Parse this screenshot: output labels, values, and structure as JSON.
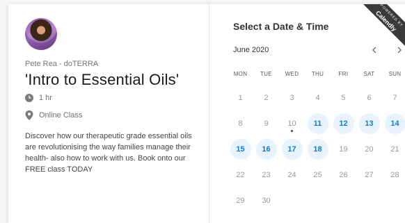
{
  "host": "Pete Rea - doTERRA",
  "event_title": "'Intro to Essential Oils'",
  "duration": "1 hr",
  "location": "Online Class",
  "description": "Discover how our therapeutic grade essential oils are revolutionising the way families manage their health- also how to work with us. Book onto our FREE class TODAY",
  "calendar": {
    "heading": "Select a Date & Time",
    "month_label": "June 2020",
    "weekdays": [
      "MON",
      "TUE",
      "WED",
      "THU",
      "FRI",
      "SAT",
      "SUN"
    ],
    "days": [
      {
        "n": "1",
        "available": false
      },
      {
        "n": "2",
        "available": false
      },
      {
        "n": "3",
        "available": false
      },
      {
        "n": "4",
        "available": false
      },
      {
        "n": "5",
        "available": false
      },
      {
        "n": "6",
        "available": false
      },
      {
        "n": "7",
        "available": false
      },
      {
        "n": "8",
        "available": false
      },
      {
        "n": "9",
        "available": false
      },
      {
        "n": "10",
        "available": false,
        "today": true
      },
      {
        "n": "11",
        "available": true
      },
      {
        "n": "12",
        "available": true
      },
      {
        "n": "13",
        "available": true
      },
      {
        "n": "14",
        "available": true
      },
      {
        "n": "15",
        "available": true
      },
      {
        "n": "16",
        "available": true
      },
      {
        "n": "17",
        "available": true
      },
      {
        "n": "18",
        "available": true
      },
      {
        "n": "19",
        "available": false
      },
      {
        "n": "20",
        "available": false
      },
      {
        "n": "21",
        "available": false
      },
      {
        "n": "22",
        "available": false
      },
      {
        "n": "23",
        "available": false
      },
      {
        "n": "24",
        "available": false
      },
      {
        "n": "25",
        "available": false
      },
      {
        "n": "26",
        "available": false
      },
      {
        "n": "27",
        "available": false
      },
      {
        "n": "28",
        "available": false
      },
      {
        "n": "29",
        "available": false
      },
      {
        "n": "30",
        "available": false
      }
    ]
  },
  "badge": {
    "top": "POWERED BY",
    "brand": "Calendly"
  },
  "icons": {
    "duration": "clock-icon",
    "location": "map-pin-icon",
    "prev": "chevron-left-icon",
    "next": "chevron-right-icon"
  },
  "colors": {
    "accent": "#0a7bd6",
    "available_bg": "#e8f3fd"
  }
}
